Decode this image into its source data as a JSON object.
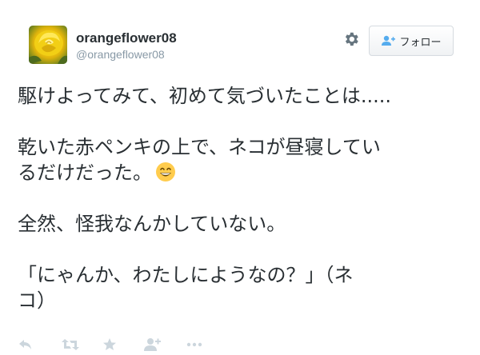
{
  "user": {
    "display_name": "orangeflower08",
    "handle": "@orangeflower08",
    "avatar_icon": "yellow-rose-avatar"
  },
  "header": {
    "settings_icon": "gear-icon",
    "follow_label": "フォロー"
  },
  "tweet": {
    "line1": "駆けよってみて、初めて気づいたことは.....",
    "line2": "乾いた赤ペンキの上で、ネコが昼寝してい",
    "line3": "るだけだった。",
    "line4": "全然、怪我なんかしていない。",
    "line5": "「にゃんか、わたしにようなの？」（ネ",
    "line6": "コ）",
    "emoji": "grinning-face-emoji"
  },
  "actions": {
    "icons": [
      "reply-icon",
      "retweet-icon",
      "favorite-icon",
      "follow-icon",
      "more-icon"
    ]
  },
  "colors": {
    "text": "#292f33",
    "muted": "#8899a6",
    "icon": "#ccd6dd",
    "accent": "#55acee"
  }
}
